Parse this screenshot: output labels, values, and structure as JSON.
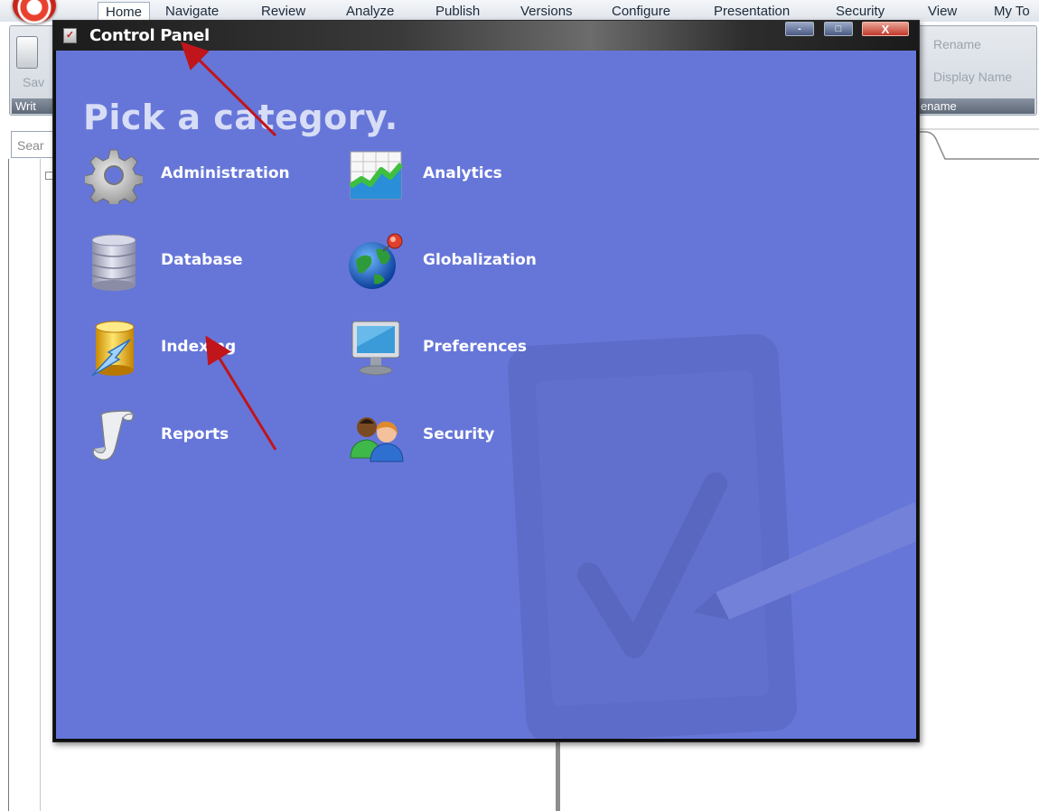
{
  "menubar": {
    "items": [
      "Home",
      "Navigate",
      "Review",
      "Analyze",
      "Publish",
      "Versions",
      "Configure",
      "Presentation",
      "Security",
      "View",
      "My To"
    ]
  },
  "ribbon": {
    "save_label": "Sav",
    "group_left_label": "Writ",
    "rename_label": "Rename",
    "display_name_label": "Display Name",
    "group_right_label": "ename"
  },
  "search": {
    "text": "Sear"
  },
  "control_panel": {
    "title": "Control Panel",
    "window_controls": {
      "minimize": "-",
      "maximize": "□",
      "close": "X"
    },
    "heading": "Pick a category.",
    "categories": [
      {
        "label": "Administration",
        "icon": "gear-icon"
      },
      {
        "label": "Analytics",
        "icon": "chart-icon"
      },
      {
        "label": "Database",
        "icon": "database-icon"
      },
      {
        "label": "Globalization",
        "icon": "globe-icon"
      },
      {
        "label": "Indexing",
        "icon": "indexing-icon"
      },
      {
        "label": "Preferences",
        "icon": "monitor-icon"
      },
      {
        "label": "Reports",
        "icon": "scroll-icon"
      },
      {
        "label": "Security",
        "icon": "users-icon"
      }
    ]
  },
  "colors": {
    "client_background": "#6676d8",
    "heading": "#d7ddf6",
    "annotation_arrow": "#c0151b"
  }
}
